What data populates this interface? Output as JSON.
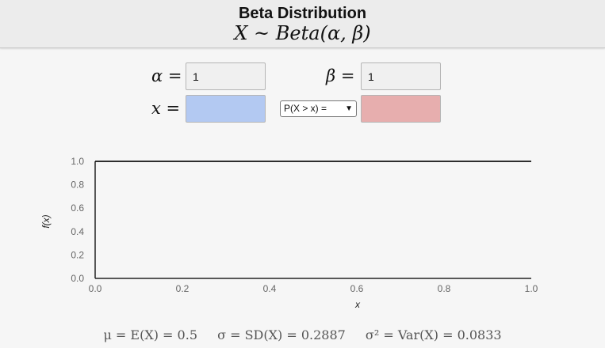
{
  "header": {
    "title": "Beta Distribution",
    "formula": "X ~ Beta(α, β)"
  },
  "params": {
    "alpha_label": "α =",
    "alpha_value": "1",
    "beta_label": "β =",
    "beta_value": "1",
    "x_label": "x =",
    "x_value": "",
    "prob_value": "",
    "prob_select": "P(X > x) ="
  },
  "chart_data": {
    "type": "line",
    "x": [
      0.0,
      1.0
    ],
    "series": [
      {
        "values": [
          1.0,
          1.0
        ]
      }
    ],
    "xlabel": "x",
    "ylabel": "f(x)",
    "xlim": [
      0,
      1
    ],
    "ylim": [
      0,
      1
    ],
    "xticks": [
      "0.0",
      "0.2",
      "0.4",
      "0.6",
      "0.8",
      "1.0"
    ],
    "yticks": [
      "0.0",
      "0.2",
      "0.4",
      "0.6",
      "0.8",
      "1.0"
    ],
    "grid": false
  },
  "stats": {
    "mean": "μ = E(X) = 0.5",
    "sd": "σ = SD(X) = 0.2887",
    "var": "σ² = Var(X) = 0.0833"
  }
}
